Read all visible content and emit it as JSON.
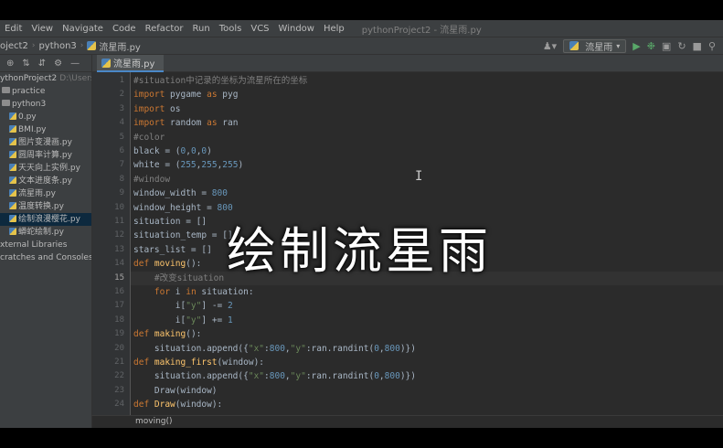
{
  "menu": {
    "items": [
      "Edit",
      "View",
      "Navigate",
      "Code",
      "Refactor",
      "Run",
      "Tools",
      "VCS",
      "Window",
      "Help"
    ],
    "window_title": "pythonProject2 - 流星雨.py"
  },
  "navbar": {
    "crumbs": [
      "oject2",
      "python3",
      "流星雨.py"
    ],
    "run_config": "流星雨"
  },
  "project_tree": [
    {
      "label": "ythonProject2",
      "hint": "D:\\Users",
      "kind": "root"
    },
    {
      "label": "practice",
      "kind": "folder"
    },
    {
      "label": "python3",
      "kind": "folder"
    },
    {
      "label": "0.py",
      "kind": "file"
    },
    {
      "label": "BMI.py",
      "kind": "file"
    },
    {
      "label": "图片变漫画.py",
      "kind": "file"
    },
    {
      "label": "圆周率计算.py",
      "kind": "file"
    },
    {
      "label": "天天向上实例.py",
      "kind": "file"
    },
    {
      "label": "文本进度条.py",
      "kind": "file"
    },
    {
      "label": "流星雨.py",
      "kind": "file"
    },
    {
      "label": "温度转换.py",
      "kind": "file"
    },
    {
      "label": "绘制浪漫樱花.py",
      "kind": "file",
      "selected": true
    },
    {
      "label": "蟒蛇绘制.py",
      "kind": "file"
    },
    {
      "label": "xternal Libraries",
      "kind": "lib"
    },
    {
      "label": "cratches and Consoles",
      "kind": "lib"
    }
  ],
  "editor": {
    "active_tab": "流星雨.py",
    "current_line": 15,
    "line_numbers": [
      "1",
      "2",
      "3",
      "4",
      "5",
      "6",
      "7",
      "8",
      "9",
      "10",
      "11",
      "12",
      "13",
      "14",
      "15",
      "16",
      "17",
      "18",
      "19",
      "20",
      "21",
      "22",
      "23",
      "24"
    ],
    "lines": [
      [
        [
          "cm",
          "#situation中记录的坐标为流星所在的坐标"
        ]
      ],
      [
        [
          "kw",
          "import "
        ],
        [
          "",
          "pygame "
        ],
        [
          "kw",
          "as "
        ],
        [
          "",
          "pyg"
        ]
      ],
      [
        [
          "kw",
          "import "
        ],
        [
          "",
          "os"
        ]
      ],
      [
        [
          "kw",
          "import "
        ],
        [
          "",
          "random "
        ],
        [
          "kw",
          "as "
        ],
        [
          "",
          "ran"
        ]
      ],
      [
        [
          "cm",
          "#color"
        ]
      ],
      [
        [
          "",
          "black = ("
        ],
        [
          "num",
          "0"
        ],
        [
          "",
          ","
        ],
        [
          "num",
          "0"
        ],
        [
          "",
          ","
        ],
        [
          "num",
          "0"
        ],
        [
          "",
          ")"
        ]
      ],
      [
        [
          "",
          "white = ("
        ],
        [
          "num",
          "255"
        ],
        [
          "",
          ","
        ],
        [
          "num",
          "255"
        ],
        [
          "",
          ","
        ],
        [
          "num",
          "255"
        ],
        [
          "",
          ")"
        ]
      ],
      [
        [
          "cm",
          "#window"
        ]
      ],
      [
        [
          "",
          "window_width = "
        ],
        [
          "num",
          "800"
        ]
      ],
      [
        [
          "",
          "window_height = "
        ],
        [
          "num",
          "800"
        ]
      ],
      [
        [
          "",
          "situation = []"
        ]
      ],
      [
        [
          "",
          "situation_temp = []"
        ]
      ],
      [
        [
          "",
          "stars_list = []"
        ]
      ],
      [
        [
          "kw",
          "def "
        ],
        [
          "fn",
          "moving"
        ],
        [
          "",
          "():"
        ]
      ],
      [
        [
          "",
          "    "
        ],
        [
          "cm",
          "#改变situation"
        ]
      ],
      [
        [
          "",
          "    "
        ],
        [
          "kw",
          "for "
        ],
        [
          "",
          "i "
        ],
        [
          "kw",
          "in "
        ],
        [
          "",
          "situation:"
        ]
      ],
      [
        [
          "",
          "        i["
        ],
        [
          "str",
          "\"y\""
        ],
        [
          "",
          "] -= "
        ],
        [
          "num",
          "2"
        ]
      ],
      [
        [
          "",
          "        i["
        ],
        [
          "str",
          "\"y\""
        ],
        [
          "",
          "] += "
        ],
        [
          "num",
          "1"
        ]
      ],
      [
        [
          "kw",
          "def "
        ],
        [
          "fn",
          "making"
        ],
        [
          "",
          "():"
        ]
      ],
      [
        [
          "",
          "    situation.append({"
        ],
        [
          "str",
          "\"x\""
        ],
        [
          "",
          ":"
        ],
        [
          "num",
          "800"
        ],
        [
          "",
          ","
        ],
        [
          "str",
          "\"y\""
        ],
        [
          "",
          ":ran.randint("
        ],
        [
          "num",
          "0"
        ],
        [
          "",
          ","
        ],
        [
          "num",
          "800"
        ],
        [
          "",
          ")})"
        ]
      ],
      [
        [
          "kw",
          "def "
        ],
        [
          "fn",
          "making_first"
        ],
        [
          "",
          "(window):"
        ]
      ],
      [
        [
          "",
          "    situation.append({"
        ],
        [
          "str",
          "\"x\""
        ],
        [
          "",
          ":"
        ],
        [
          "num",
          "800"
        ],
        [
          "",
          ","
        ],
        [
          "str",
          "\"y\""
        ],
        [
          "",
          ":ran.randint("
        ],
        [
          "num",
          "0"
        ],
        [
          "",
          ","
        ],
        [
          "num",
          "800"
        ],
        [
          "",
          ")})"
        ]
      ],
      [
        [
          "",
          "    Draw(window)"
        ]
      ],
      [
        [
          "kw",
          "def "
        ],
        [
          "fn",
          "Draw"
        ],
        [
          "",
          "(window):"
        ]
      ]
    ]
  },
  "overlay_caption": "绘制流星雨",
  "breadcrumb": "moving()"
}
